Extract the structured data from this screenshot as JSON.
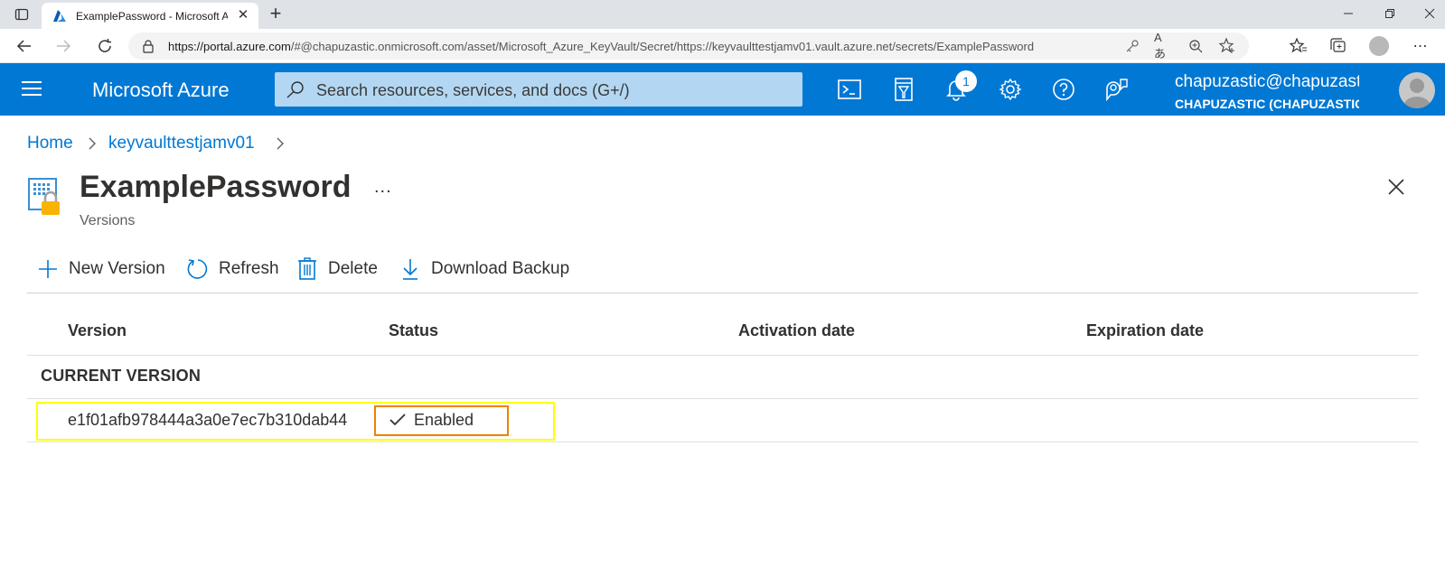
{
  "browser": {
    "tab_title": "ExamplePassword - Microsoft Azure",
    "url_host": "https://portal.azure.com",
    "url_path": "/#@chapuzastic.onmicrosoft.com/asset/Microsoft_Azure_KeyVault/Secret/https://keyvaulttestjamv01.vault.azure.net/secrets/ExamplePassword",
    "icons": [
      "tab-actions-icon",
      "azure-logo-icon",
      "close-tab-icon",
      "new-tab-icon",
      "minimize-icon",
      "restore-icon",
      "close-window-icon",
      "back-icon",
      "forward-icon",
      "refresh-icon",
      "lock-icon",
      "key-icon",
      "read-aloud-icon",
      "zoom-icon",
      "add-favorite-icon",
      "favorites-icon",
      "collections-icon",
      "profile-icon",
      "settings-more-icon"
    ]
  },
  "header": {
    "brand": "Microsoft Azure",
    "search_placeholder": "Search resources, services, and docs (G+/)",
    "notification_count": "1",
    "user_name": "chapuzastic@chapuzastic.onmicrosoft.com",
    "user_tenant": "CHAPUZASTIC (CHAPUZASTIC.ONMICROSOFT.COM)",
    "accent_color": "#0078d4"
  },
  "breadcrumb": {
    "items": [
      "Home",
      "keyvaulttestjamv01"
    ]
  },
  "page": {
    "title": "ExamplePassword",
    "more": "...",
    "subtitle": "Versions"
  },
  "commands": {
    "new_version": "New Version",
    "refresh": "Refresh",
    "delete": "Delete",
    "download_backup": "Download Backup"
  },
  "table": {
    "columns": [
      "Version",
      "Status",
      "Activation date",
      "Expiration date"
    ],
    "group_label": "CURRENT VERSION",
    "rows": [
      {
        "version": "e1f01afb978444a3a0e7ec7b310dab44",
        "status": "Enabled",
        "activation_date": "",
        "expiration_date": ""
      }
    ],
    "row_highlight_color": "#ffff00",
    "status_highlight_color": "#f08000"
  }
}
